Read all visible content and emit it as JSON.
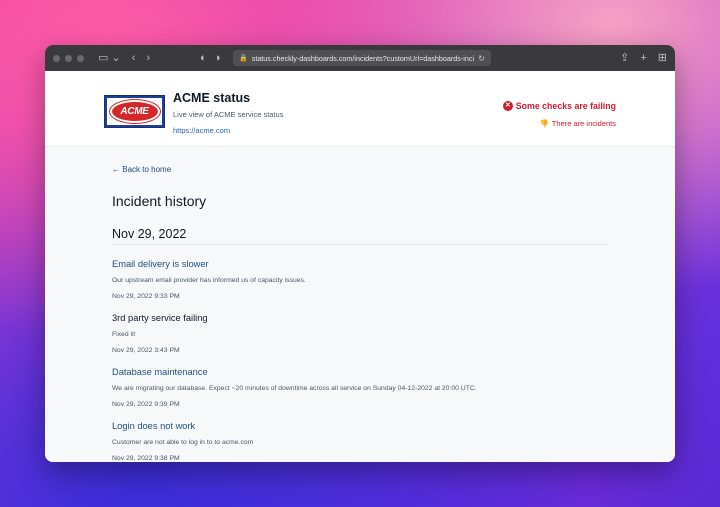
{
  "browser": {
    "url": "status.checkly-dashboards.com/incidents?customUrl=dashboards-inci",
    "icons": [
      "sidebar-icon",
      "back-icon",
      "forward-icon",
      "privacy-icon",
      "shield-icon",
      "lock-icon",
      "reload-icon",
      "share-icon",
      "new-tab-icon",
      "tabs-overview-icon"
    ]
  },
  "header": {
    "logo_text": "ACME",
    "title": "ACME status",
    "subtitle": "Live view of ACME service status",
    "link": "https://acme.com",
    "status_failing": "Some checks are failing",
    "status_incidents": "There are incidents"
  },
  "main": {
    "back_label": "Back to home",
    "heading": "Incident history",
    "date_heading": "Nov 29, 2022",
    "incidents": [
      {
        "title": "Email delivery is slower",
        "description": "Our upstream email provider has informed us of capacity issues.",
        "time": "Nov 29, 2022 9:33 PM"
      },
      {
        "title": "3rd party service failing",
        "description": "Fixed it!",
        "time": "Nov 29, 2022 3:43 PM"
      },
      {
        "title": "Database maintenance",
        "description": "We are migrating our database. Expect ~20 minutes of downtime across all service on Sunday 04-12-2022 at 20:00 UTC.",
        "time": "Nov 29, 2022 9:39 PM"
      },
      {
        "title": "Login does not work",
        "description": "Customer are not able to log in to to acme.com",
        "time": "Nov 29, 2022 9:38 PM"
      }
    ]
  },
  "colors": {
    "accent": "#1e4f80",
    "error": "#d11a2a",
    "logo_blue": "#1f3f93",
    "logo_red": "#d3272a"
  }
}
